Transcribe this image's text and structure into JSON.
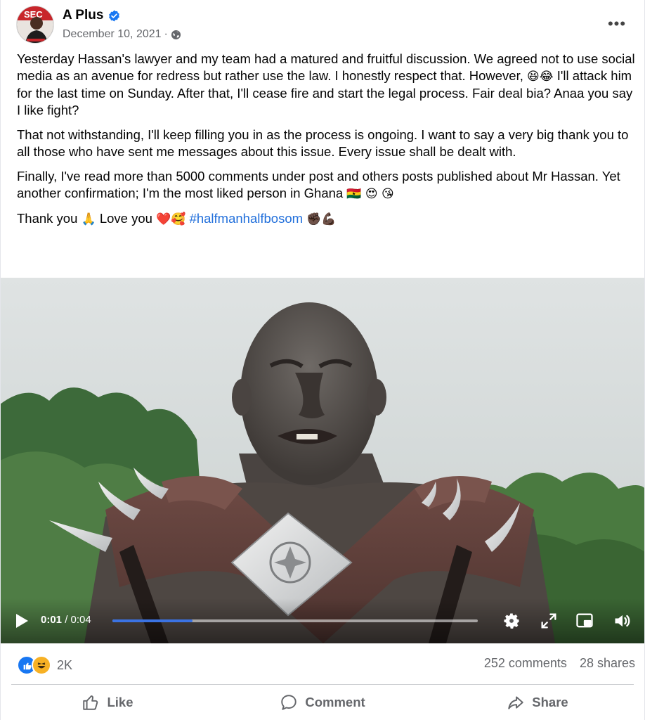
{
  "post": {
    "author": "A Plus",
    "verified": true,
    "date": "December 10, 2021",
    "separator": "·",
    "privacy_icon": "globe-icon",
    "more_label": "•••",
    "paragraphs": [
      {
        "text_a": "Yesterday Hassan's  lawyer and my team had a matured and fruitful discussion. We agreed not to use social media as an avenue for redress but rather use the law. I honestly respect that. However,",
        "emoji_a": "😆😂",
        "text_b": " I'll attack him for the last time on Sunday. After that, I'll cease fire and start the legal process. Fair deal bia? Anaa you say I like fight?"
      },
      {
        "text": "That not withstanding, I'll keep filling you in as the process is ongoing. I want to say a very big thank you to all those who have sent me messages about this issue. Every issue shall be dealt with."
      },
      {
        "text": "Finally, I've read more than 5000 comments under post and others posts published about Mr Hassan. Yet another confirmation; I'm the most liked person in Ghana",
        "emoji": "🇬🇭 😍 😘"
      },
      {
        "text_a": "Thank you",
        "emoji_a": "🙏",
        "text_b": " Love you ",
        "emoji_b": "❤️🥰",
        "hashtag": "#halfmanhalfbosom",
        "emoji_c": "✊🏿💪🏿"
      }
    ]
  },
  "video": {
    "current_time": "0:01",
    "separator": " / ",
    "duration": "0:04",
    "progress": 0.22,
    "accent_color": "#3b73e3",
    "icons": [
      "play-icon",
      "settings-gear-icon",
      "fullscreen-icon",
      "picture-in-picture-icon",
      "volume-icon"
    ]
  },
  "stats": {
    "reactions": [
      "like-reaction-icon",
      "haha-reaction-icon"
    ],
    "reaction_count": "2K",
    "comments": "252 comments",
    "shares": "28 shares"
  },
  "actions": {
    "like": "Like",
    "comment": "Comment",
    "share": "Share"
  },
  "colors": {
    "hashtag": "#216fdb",
    "secondary_text": "#65676b",
    "like_blue": "#1877f2"
  }
}
